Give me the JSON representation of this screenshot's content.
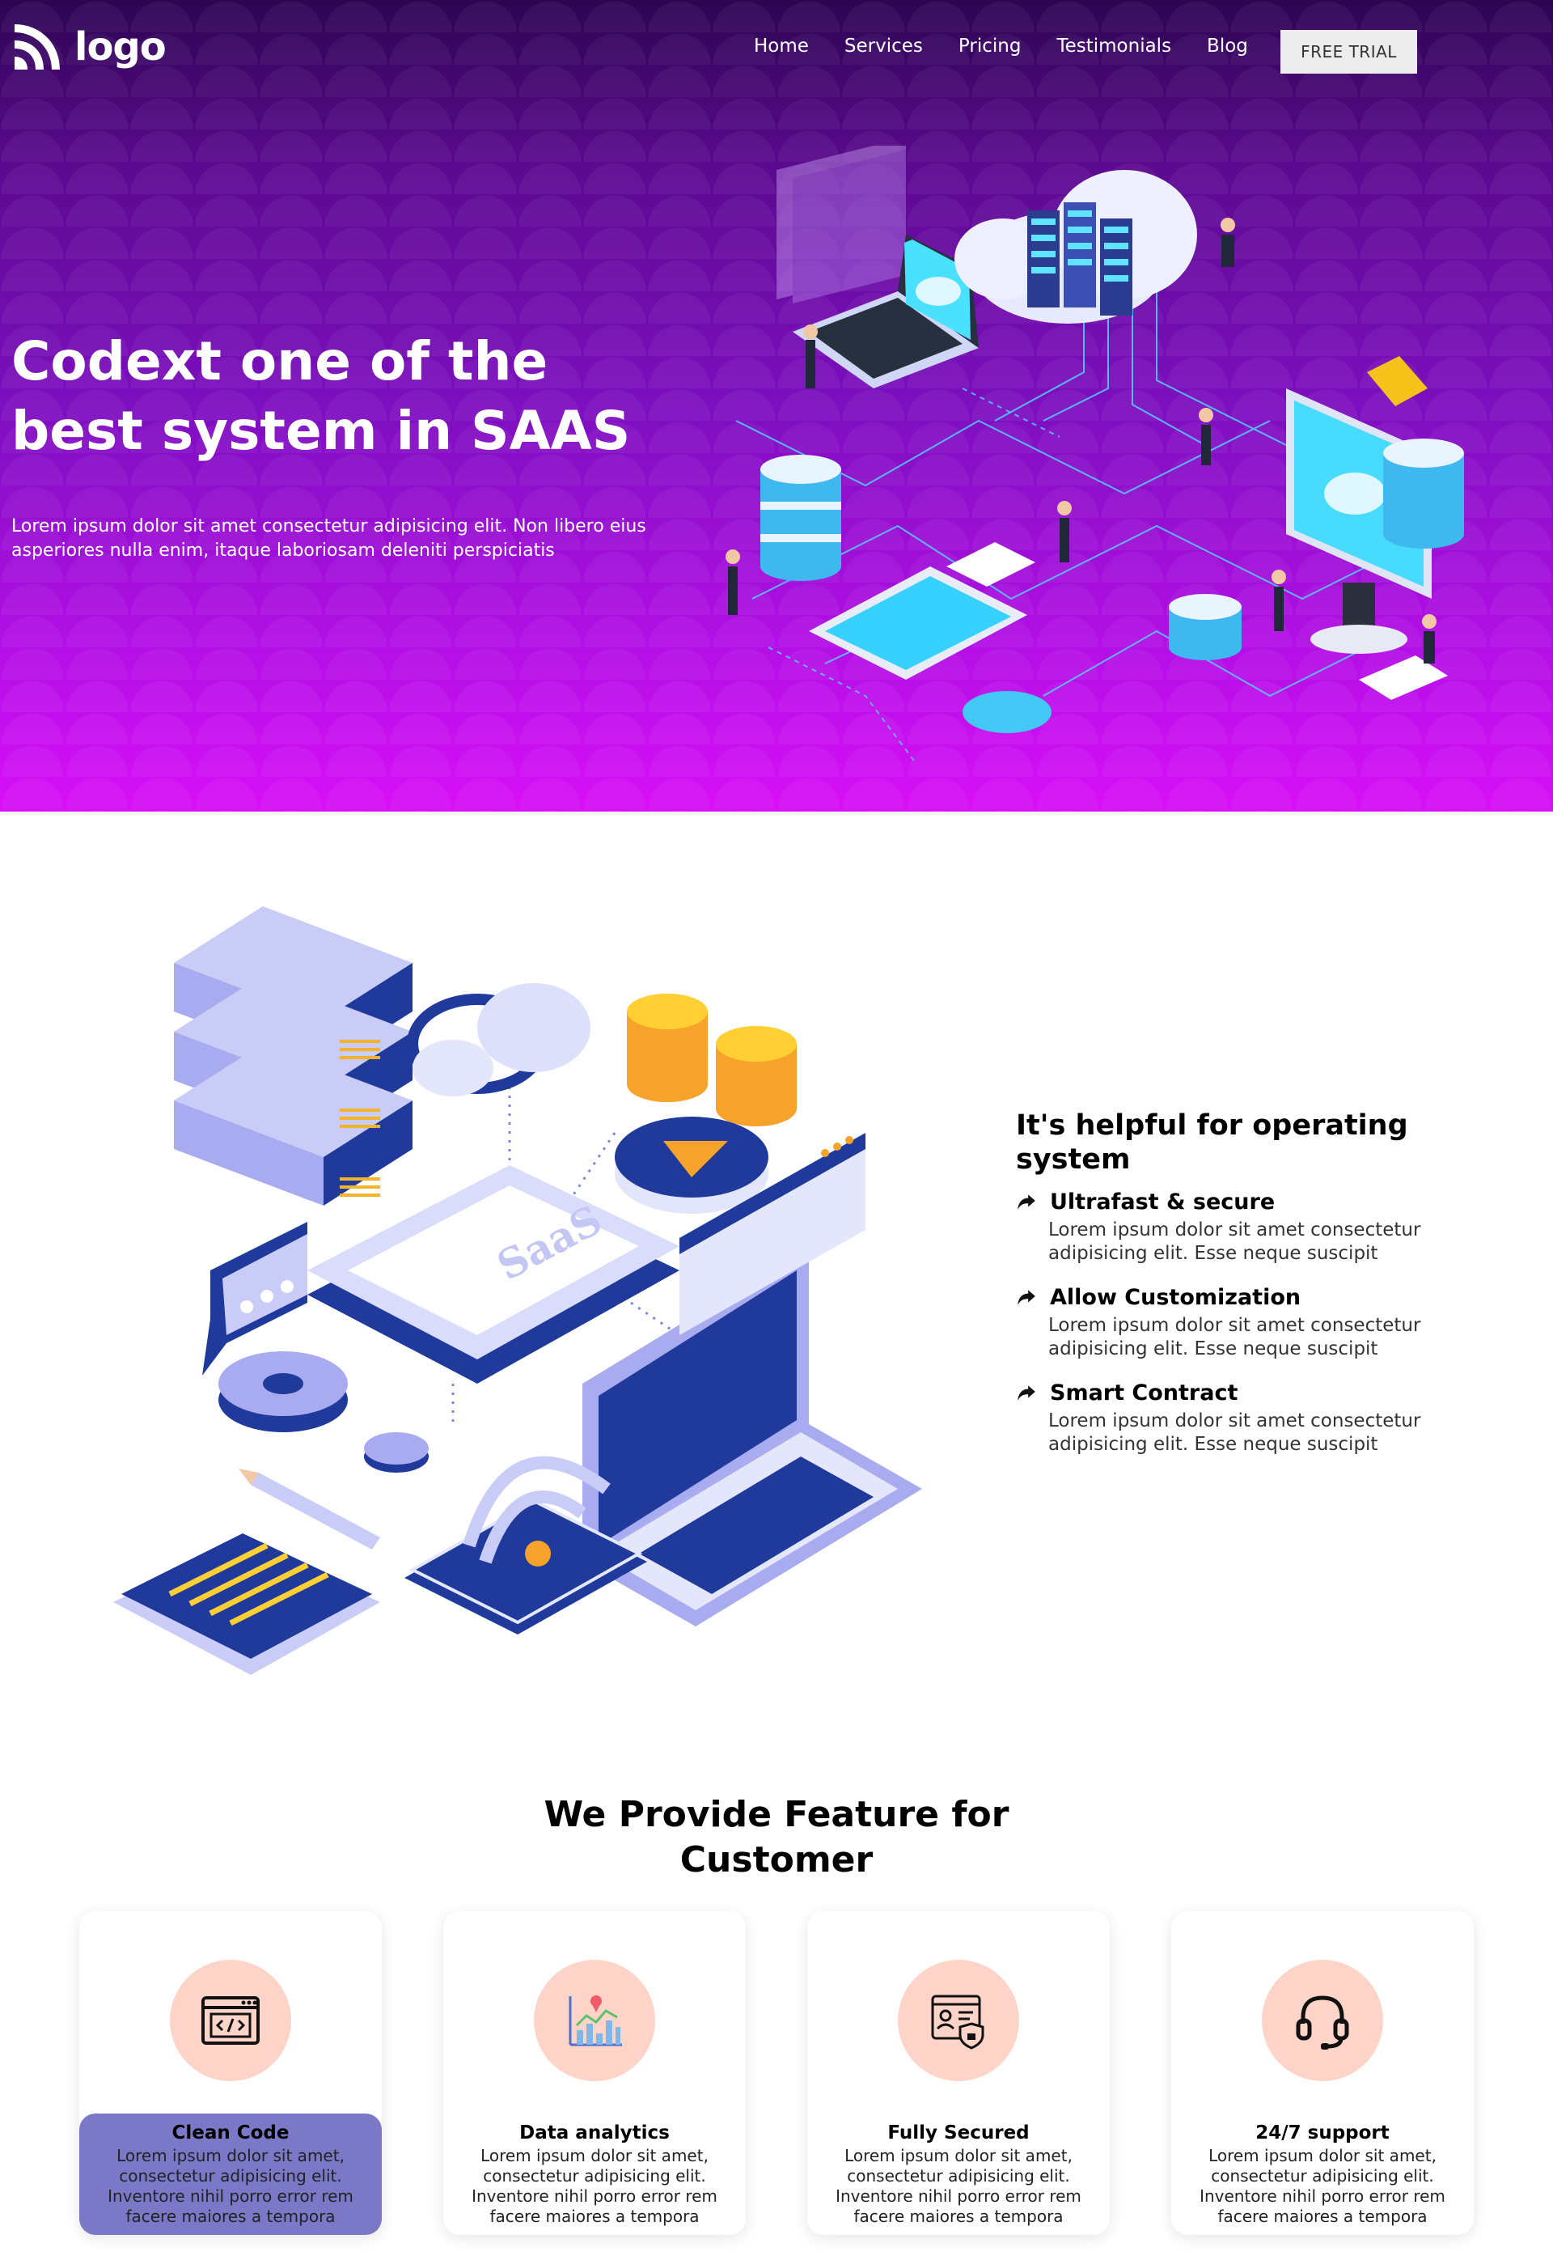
{
  "brand": {
    "logo_text": "logo"
  },
  "nav": {
    "items": [
      "Home",
      "Services",
      "Pricing",
      "Testimonials",
      "Blog"
    ],
    "cta_label": "FREE TRIAL"
  },
  "hero": {
    "title": "Codext one of the best system in SAAS",
    "subtitle": "Lorem ipsum dolor sit amet consectetur adipisicing elit. Non libero eius asperiores nulla enim, itaque laboriosam deleniti perspiciatis"
  },
  "helpful": {
    "title": "It's helpful for operating system",
    "items": [
      {
        "name": "Ultrafast & secure",
        "desc": "Lorem ipsum dolor sit amet consectetur adipisicing elit. Esse neque suscipit"
      },
      {
        "name": "Allow Customization",
        "desc": "Lorem ipsum dolor sit amet consectetur adipisicing elit. Esse neque suscipit"
      },
      {
        "name": "Smart Contract",
        "desc": "Lorem ipsum dolor sit amet consectetur adipisicing elit. Esse neque suscipit"
      }
    ]
  },
  "features": {
    "title": "We Provide Feature for Customer",
    "cards": [
      {
        "title": "Clean Code",
        "desc": "Lorem ipsum dolor sit amet, consectetur adipisicing elit. Inventore nihil porro error rem facere maiores a tempora",
        "icon": "code-window-icon"
      },
      {
        "title": "Data analytics",
        "desc": "Lorem ipsum dolor sit amet, consectetur adipisicing elit. Inventore nihil porro error rem facere maiores a tempora",
        "icon": "analytics-chart-icon"
      },
      {
        "title": "Fully Secured",
        "desc": "Lorem ipsum dolor sit amet, consectetur adipisicing elit. Inventore nihil porro error rem facere maiores a tempora",
        "icon": "shield-profile-icon"
      },
      {
        "title": "24/7 support",
        "desc": "Lorem ipsum dolor sit amet, consectetur adipisicing elit. Inventore nihil porro error rem facere maiores a tempora",
        "icon": "headset-icon"
      }
    ]
  },
  "illustration_text": {
    "saas_label": "SaaS"
  },
  "colors": {
    "hero_top": "#2c0552",
    "hero_bottom": "#d70ff7",
    "card_icon_bg": "#fdd4c7",
    "card_active_bg": "#7b78c8"
  }
}
